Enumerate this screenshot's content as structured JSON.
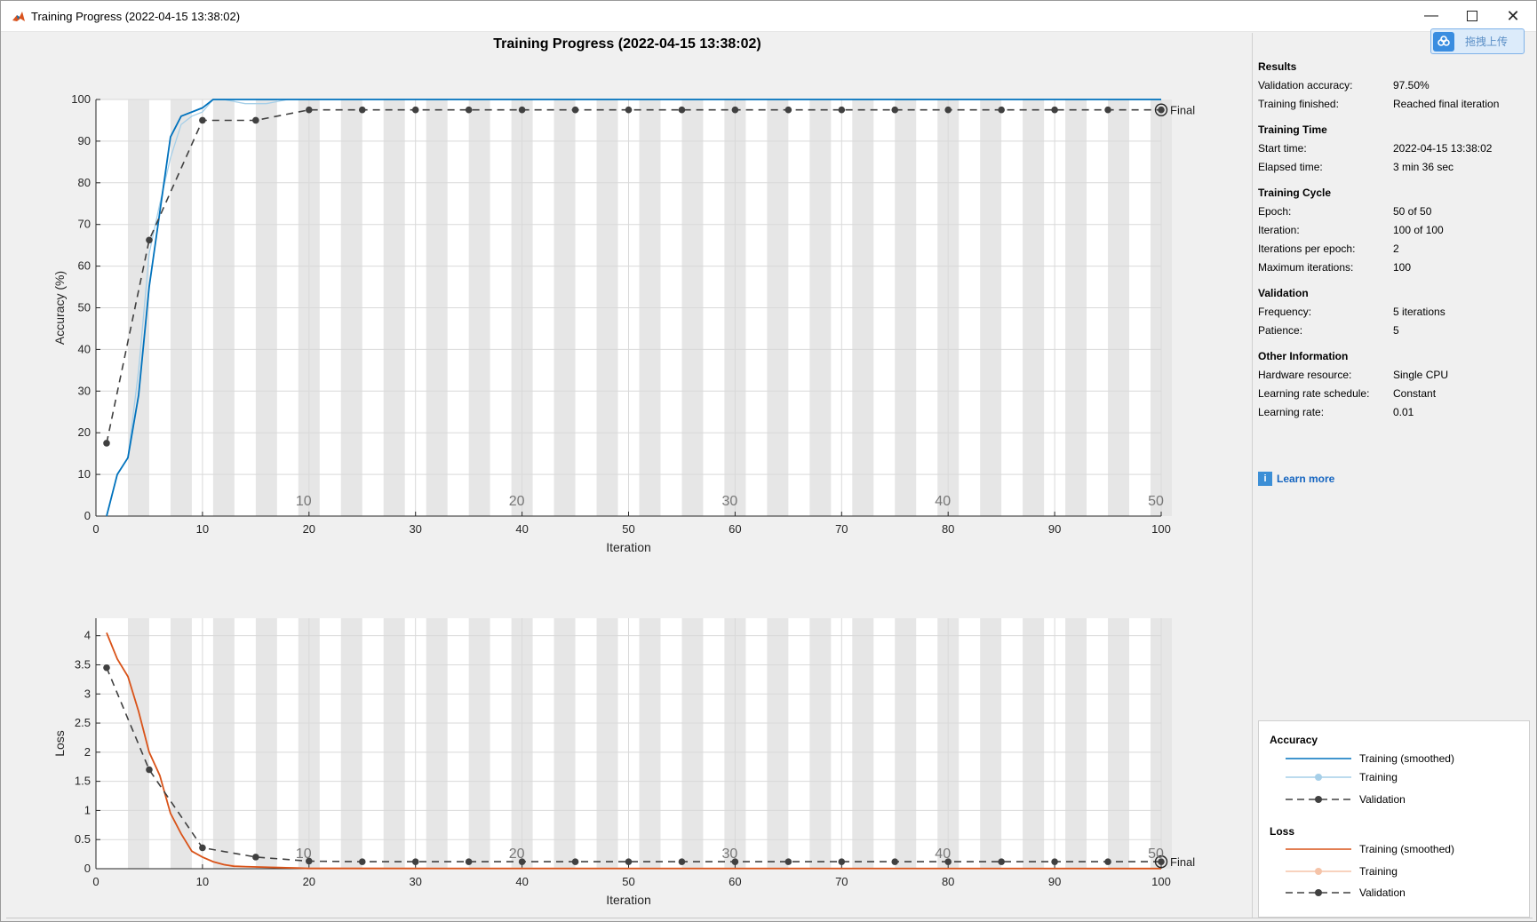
{
  "window": {
    "title": "Training Progress (2022-04-15 13:38:02)",
    "controls": [
      "minimize-icon",
      "maximize-icon",
      "close-icon"
    ],
    "upload_label": "拖拽上传"
  },
  "figure_title": "Training Progress (2022-04-15 13:38:02)",
  "colors": {
    "acc_smoothed": "#0072bd",
    "acc_training": "#a6cfe8",
    "loss_smoothed": "#d95319",
    "loss_training": "#f5c3a8",
    "validation": "#404040",
    "epoch_band": "#e6e6e6"
  },
  "info": {
    "sections": [
      {
        "head": "Results",
        "rows": [
          [
            "Validation accuracy:",
            "97.50%"
          ],
          [
            "Training finished:",
            "Reached final iteration"
          ]
        ]
      },
      {
        "head": "Training Time",
        "rows": [
          [
            "Start time:",
            "2022-04-15 13:38:02"
          ],
          [
            "Elapsed time:",
            "3 min 36 sec"
          ]
        ]
      },
      {
        "head": "Training Cycle",
        "rows": [
          [
            "Epoch:",
            "50 of 50"
          ],
          [
            "Iteration:",
            "100 of 100"
          ],
          [
            "Iterations per epoch:",
            "2"
          ],
          [
            "Maximum iterations:",
            "100"
          ]
        ]
      },
      {
        "head": "Validation",
        "rows": [
          [
            "Frequency:",
            "5 iterations"
          ],
          [
            "Patience:",
            "5"
          ]
        ]
      },
      {
        "head": "Other Information",
        "rows": [
          [
            "Hardware resource:",
            "Single CPU"
          ],
          [
            "Learning rate schedule:",
            "Constant"
          ],
          [
            "Learning rate:",
            "0.01"
          ]
        ]
      }
    ],
    "learn_more": "Learn more"
  },
  "legend": {
    "accuracy_head": "Accuracy",
    "loss_head": "Loss",
    "smoothed": "Training (smoothed)",
    "training": "Training",
    "validation": "Validation"
  },
  "chart_data": [
    {
      "type": "line",
      "ylabel": "Accuracy (%)",
      "xlabel": "Iteration",
      "xlim": [
        0,
        100
      ],
      "ylim": [
        0,
        100
      ],
      "x_ticks": [
        0,
        10,
        20,
        30,
        40,
        50,
        60,
        70,
        80,
        90,
        100
      ],
      "y_ticks": [
        0,
        10,
        20,
        30,
        40,
        50,
        60,
        70,
        80,
        90,
        100
      ],
      "epoch_labels": [
        10,
        20,
        30,
        40,
        50
      ],
      "final_label": "Final",
      "series": [
        {
          "name": "Training (smoothed)",
          "x": [
            1,
            2,
            3,
            4,
            5,
            6,
            7,
            8,
            9,
            10,
            11,
            12,
            20,
            100
          ],
          "values": [
            0,
            10,
            14,
            29,
            55,
            73,
            91,
            96,
            97,
            98,
            100,
            100,
            100,
            100
          ]
        },
        {
          "name": "Training",
          "x": [
            1,
            2,
            3,
            4,
            5,
            6,
            7,
            8,
            9,
            10,
            11,
            12,
            14,
            16,
            18,
            20,
            100
          ],
          "values": [
            0,
            10,
            14,
            35,
            63,
            75,
            86,
            94,
            96,
            97,
            100,
            100,
            99,
            99,
            100,
            100,
            100
          ]
        },
        {
          "name": "Validation",
          "x": [
            1,
            5,
            10,
            15,
            20,
            25,
            30,
            35,
            40,
            45,
            50,
            55,
            60,
            65,
            70,
            75,
            80,
            85,
            90,
            95,
            100
          ],
          "values": [
            17.5,
            66.25,
            95,
            95,
            97.5,
            97.5,
            97.5,
            97.5,
            97.5,
            97.5,
            97.5,
            97.5,
            97.5,
            97.5,
            97.5,
            97.5,
            97.5,
            97.5,
            97.5,
            97.5,
            97.5
          ]
        }
      ]
    },
    {
      "type": "line",
      "ylabel": "Loss",
      "xlabel": "Iteration",
      "xlim": [
        0,
        100
      ],
      "ylim": [
        0,
        4.3
      ],
      "x_ticks": [
        0,
        10,
        20,
        30,
        40,
        50,
        60,
        70,
        80,
        90,
        100
      ],
      "y_ticks": [
        0,
        0.5,
        1,
        1.5,
        2,
        2.5,
        3,
        3.5,
        4
      ],
      "epoch_labels": [
        10,
        20,
        30,
        40,
        50
      ],
      "final_label": "Final",
      "series": [
        {
          "name": "Training (smoothed)",
          "x": [
            1,
            2,
            3,
            4,
            5,
            6,
            7,
            8,
            9,
            10,
            11,
            12,
            13,
            15,
            17,
            19,
            20,
            100
          ],
          "values": [
            4.05,
            3.6,
            3.3,
            2.7,
            2.0,
            1.6,
            0.95,
            0.6,
            0.3,
            0.2,
            0.12,
            0.07,
            0.04,
            0.03,
            0.02,
            0.01,
            0.005,
            0.003
          ]
        },
        {
          "name": "Training",
          "x": [
            1,
            2,
            3,
            4,
            5,
            6,
            7,
            8,
            9,
            10,
            11,
            12,
            14,
            20,
            100
          ],
          "values": [
            4.05,
            3.6,
            3.3,
            2.7,
            2.0,
            1.6,
            0.95,
            0.6,
            0.3,
            0.2,
            0.12,
            0.07,
            0.04,
            0.01,
            0.003
          ]
        },
        {
          "name": "Validation",
          "x": [
            1,
            5,
            10,
            15,
            20,
            25,
            30,
            35,
            40,
            45,
            50,
            55,
            60,
            65,
            70,
            75,
            80,
            85,
            90,
            95,
            100
          ],
          "values": [
            3.45,
            1.7,
            0.36,
            0.2,
            0.13,
            0.12,
            0.12,
            0.12,
            0.12,
            0.12,
            0.12,
            0.12,
            0.12,
            0.12,
            0.12,
            0.12,
            0.12,
            0.12,
            0.12,
            0.12,
            0.12
          ]
        }
      ]
    }
  ]
}
